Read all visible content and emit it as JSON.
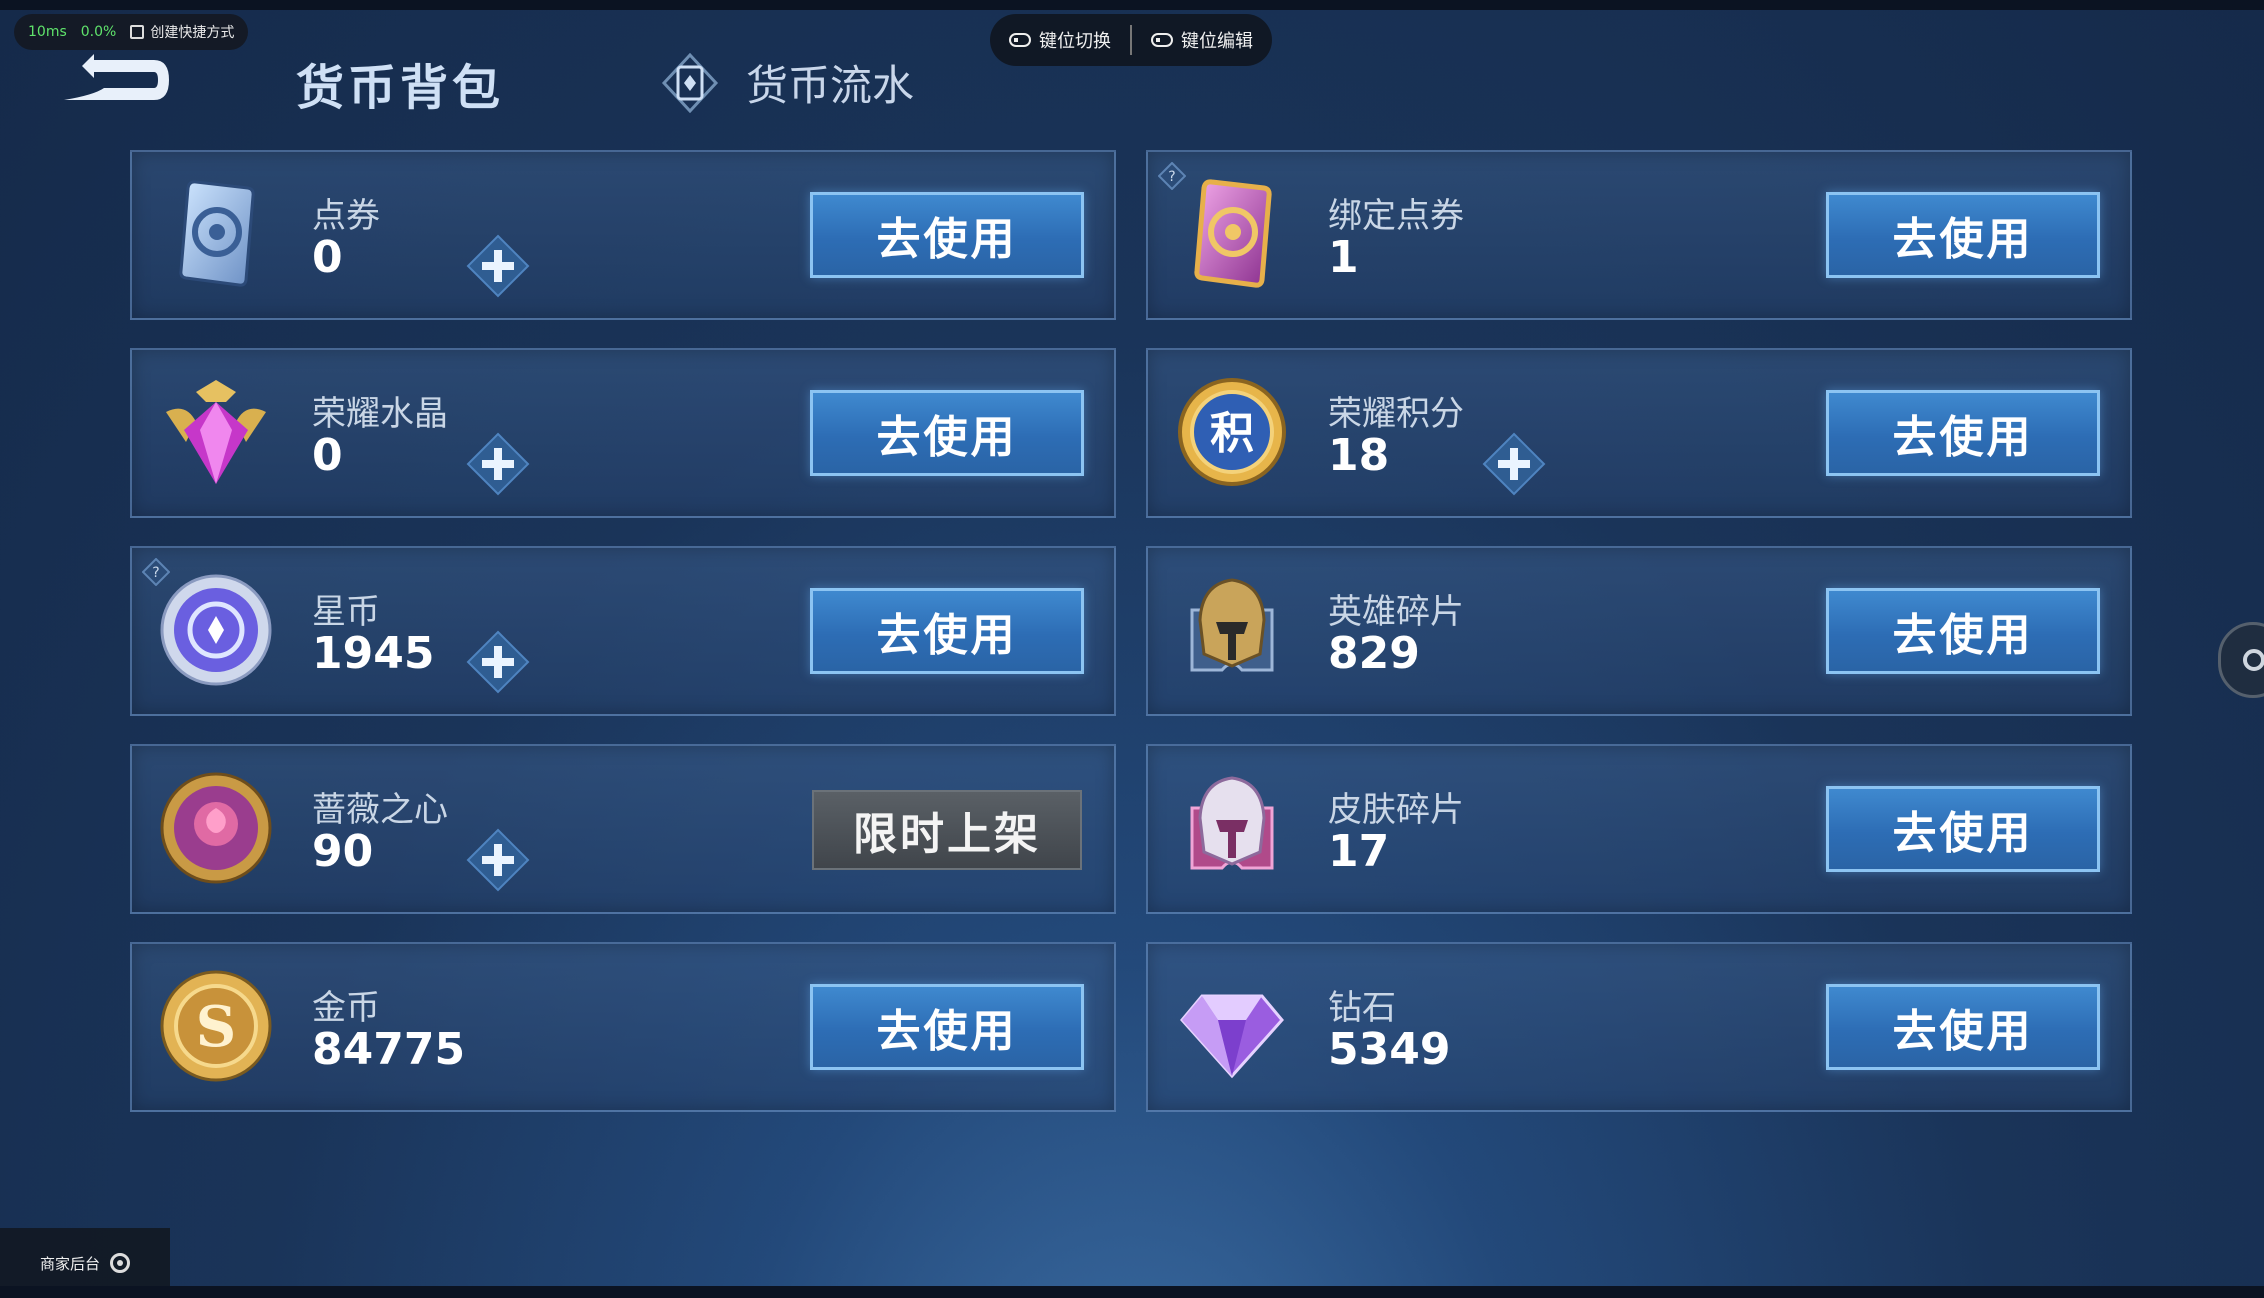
{
  "overlay": {
    "latency": "10ms",
    "loss": "0.0%",
    "shortcut_label": "创建快捷方式"
  },
  "keybar": {
    "switch_label": "键位切换",
    "edit_label": "键位编辑"
  },
  "header": {
    "title": "货币背包",
    "flow_tab_label": "货币流水"
  },
  "currencies": [
    {
      "name": "点券",
      "value": "0",
      "has_plus": true,
      "button": "去使用",
      "icon": "ticket-card-icon"
    },
    {
      "name": "绑定点券",
      "value": "1",
      "has_plus": false,
      "button": "去使用",
      "icon": "bound-ticket-icon",
      "help": true
    },
    {
      "name": "荣耀水晶",
      "value": "0",
      "has_plus": true,
      "button": "去使用",
      "icon": "glory-crystal-icon"
    },
    {
      "name": "荣耀积分",
      "value": "18",
      "has_plus": true,
      "button": "去使用",
      "icon": "glory-points-icon"
    },
    {
      "name": "星币",
      "value": "1945",
      "has_plus": true,
      "button": "去使用",
      "icon": "star-coin-icon",
      "help": true
    },
    {
      "name": "英雄碎片",
      "value": "829",
      "has_plus": false,
      "button": "去使用",
      "icon": "hero-fragment-icon"
    },
    {
      "name": "蔷薇之心",
      "value": "90",
      "has_plus": true,
      "button": "限时上架",
      "icon": "rose-heart-icon"
    },
    {
      "name": "皮肤碎片",
      "value": "17",
      "has_plus": false,
      "button": "去使用",
      "icon": "skin-fragment-icon"
    },
    {
      "name": "金币",
      "value": "84775",
      "has_plus": false,
      "button": "去使用",
      "icon": "gold-coin-icon"
    },
    {
      "name": "钻石",
      "value": "5349",
      "has_plus": false,
      "button": "去使用",
      "icon": "diamond-icon"
    }
  ],
  "footer": {
    "merchant_label": "商家后台"
  },
  "colors": {
    "button_blue": "#3f89cf",
    "button_border": "#8cc4f2",
    "limited_gray": "#4a5056",
    "background": "#1a3459"
  }
}
